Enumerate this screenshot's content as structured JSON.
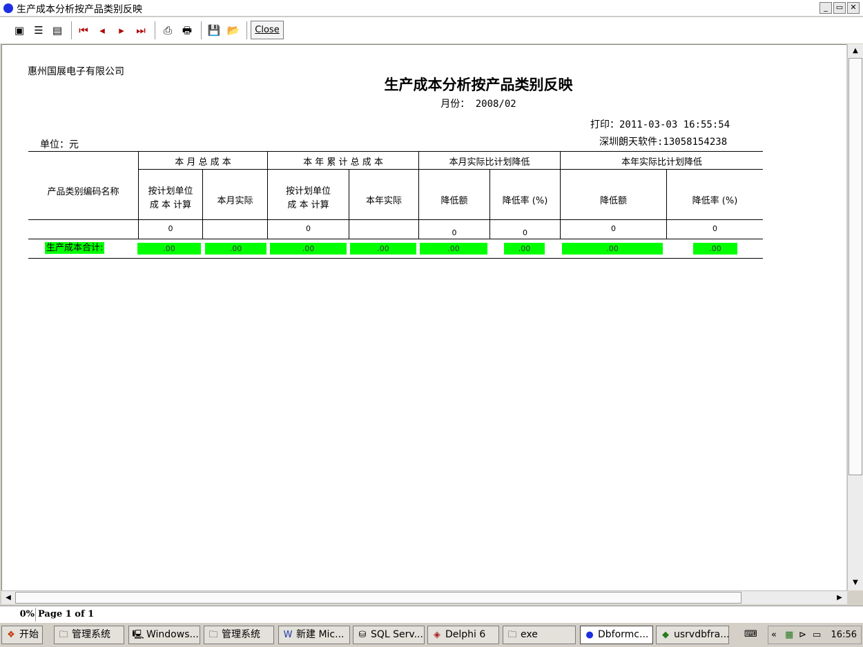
{
  "window": {
    "title": "生产成本分析按产品类别反映",
    "min_label": "_",
    "restore_label": "▭",
    "close_label": "✕"
  },
  "toolbar": {
    "close_label": "Close"
  },
  "report": {
    "company": "惠州国展电子有限公司",
    "title": "生产成本分析按产品类别反映",
    "month": "月份： 2008/02",
    "printed": "打印：2011-03-03 16:55:54",
    "software": "深圳朗天软件:13058154238",
    "unit": "单位：元",
    "table": {
      "group_headers": [
        "本 月 总 成 本",
        "本 年 累 计 总 成 本",
        "本月实际比计划降低",
        "本年实际比计划降低"
      ],
      "row_header": "产品类别编码名称",
      "col_month_plan": [
        "按计划单位",
        "成 本 计算"
      ],
      "col_month_actual": "本月实际",
      "col_year_plan": [
        "按计划单位",
        "成 本 计算"
      ],
      "col_year_actual": "本年实际",
      "col_reduce_amount": "降低额",
      "col_reduce_rate": "降低率 (%)",
      "col_year_reduce_amount": "降低额",
      "col_year_reduce_rate": "降低率 (%)",
      "zero_row": [
        "0",
        "0",
        "0",
        "0",
        "0",
        "0"
      ],
      "total_label": "生产成本合计:",
      "totals": [
        ".00",
        ".00",
        ".00",
        ".00",
        ".00",
        ".00",
        ".00",
        ".00"
      ]
    }
  },
  "status": {
    "zoom": "0%",
    "page": "Page 1 of 1"
  },
  "taskbar": {
    "start": "开始",
    "tasks": [
      "管理系统",
      "Windows...",
      "管理系统",
      "新建 Mic...",
      "SQL Serv...",
      "Delphi 6",
      "exe",
      "Dbformc...",
      "usrvdbfra..."
    ],
    "clock": "16:56"
  }
}
